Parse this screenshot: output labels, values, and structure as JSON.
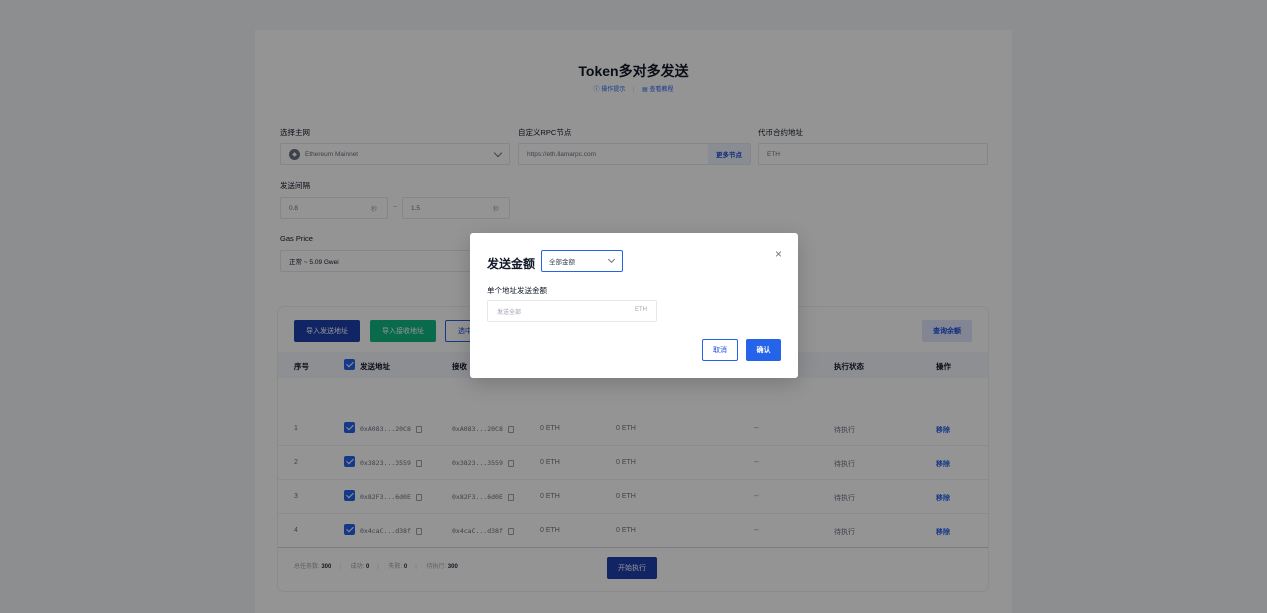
{
  "header": {
    "title": "Token多对多发送",
    "links": [
      "操作提示",
      "查看教程"
    ]
  },
  "form": {
    "network_label": "选择主网",
    "network_value": "Ethereum Mainnet",
    "rpc_label": "自定义RPC节点",
    "rpc_value": "https://eth.llamarpc.com",
    "more_nodes": "更多节点",
    "contract_label": "代币合约地址",
    "contract_value": "ETH",
    "interval_label": "发送间隔",
    "interval_min": "0.8",
    "interval_max": "1.5",
    "interval_unit": "秒",
    "gas_label": "Gas Price",
    "gas_value": "正常 ~ 5.09 Gwei"
  },
  "toolbar": {
    "import_send": "导入发送地址",
    "import_receive": "导入接收地址",
    "selected": "选中",
    "query_balance": "查询余额"
  },
  "table": {
    "headers": [
      "序号",
      "发送地址",
      "接收",
      "执行状态",
      "操作"
    ],
    "rows": [
      {
        "index": "1",
        "from": "0xA083...20C8",
        "to": "0xA083...20C8",
        "bal1": "0 ETH",
        "bal2": "0 ETH",
        "dash": "--",
        "status": "待执行",
        "action": "移除"
      },
      {
        "index": "2",
        "from": "0x3823...3559",
        "to": "0x3823...3559",
        "bal1": "0 ETH",
        "bal2": "0 ETH",
        "dash": "--",
        "status": "待执行",
        "action": "移除"
      },
      {
        "index": "3",
        "from": "0x82F3...6d0E",
        "to": "0x82F3...6d0E",
        "bal1": "0 ETH",
        "bal2": "0 ETH",
        "dash": "--",
        "status": "待执行",
        "action": "移除"
      },
      {
        "index": "4",
        "from": "0x4caC...d38f",
        "to": "0x4caC...d38f",
        "bal1": "0 ETH",
        "bal2": "0 ETH",
        "dash": "--",
        "status": "待执行",
        "action": "移除"
      }
    ]
  },
  "summary": {
    "total_label": "总任务数:",
    "total": "300",
    "success_label": "成功:",
    "success": "0",
    "fail_label": "失败:",
    "fail": "0",
    "pending_label": "待执行:",
    "pending": "300"
  },
  "start_button": "开始执行",
  "modal": {
    "title": "发送金额",
    "select_value": "全部金额",
    "sub_label": "单个地址发送金额",
    "input_placeholder": "发送全部",
    "unit": "ETH",
    "cancel": "取消",
    "confirm": "确认",
    "close": "×"
  }
}
